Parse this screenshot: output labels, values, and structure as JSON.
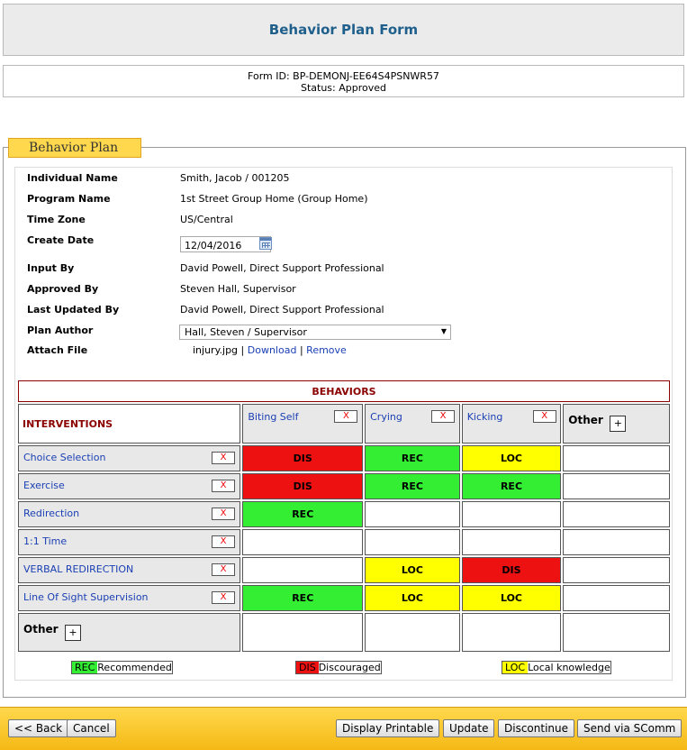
{
  "header": {
    "title": "Behavior Plan Form",
    "form_id": "Form ID: BP-DEMONJ-EE64S4PSNWR57",
    "status": "Status: Approved"
  },
  "section": {
    "legend": "Behavior Plan"
  },
  "fields": {
    "individual_name": {
      "label": "Individual Name",
      "value": "Smith, Jacob / 001205"
    },
    "program_name": {
      "label": "Program Name",
      "value": "1st Street Group Home (Group Home)"
    },
    "time_zone": {
      "label": "Time Zone",
      "value": "US/Central"
    },
    "create_date": {
      "label": "Create Date",
      "value": "12/04/2016"
    },
    "input_by": {
      "label": "Input By",
      "value": "David Powell, Direct Support Professional"
    },
    "approved_by": {
      "label": "Approved By",
      "value": "Steven Hall, Supervisor"
    },
    "last_updated_by": {
      "label": "Last Updated By",
      "value": "David Powell, Direct Support Professional"
    },
    "plan_author": {
      "label": "Plan Author",
      "value": "Hall, Steven / Supervisor"
    },
    "attach_file": {
      "label": "Attach File",
      "filename": "injury.jpg",
      "sep": "|",
      "download": "Download",
      "remove": "Remove"
    }
  },
  "grid": {
    "behaviors_title": "BEHAVIORS",
    "interventions_title": "INTERVENTIONS",
    "other_label": "Other",
    "remove_glyph": "X",
    "add_glyph": "+",
    "behaviors": [
      "Biting Self",
      "Crying",
      "Kicking"
    ],
    "interventions": [
      {
        "name": "Choice Selection",
        "cells": [
          "DIS",
          "REC",
          "LOC",
          ""
        ]
      },
      {
        "name": "Exercise",
        "cells": [
          "DIS",
          "REC",
          "REC",
          ""
        ]
      },
      {
        "name": "Redirection",
        "cells": [
          "REC",
          "",
          "",
          ""
        ]
      },
      {
        "name": "1:1 Time",
        "cells": [
          "",
          "",
          "",
          ""
        ]
      },
      {
        "name": "VERBAL REDIRECTION",
        "cells": [
          "",
          "LOC",
          "DIS",
          ""
        ]
      },
      {
        "name": "Line Of Sight Supervision",
        "cells": [
          "REC",
          "LOC",
          "LOC",
          ""
        ]
      }
    ]
  },
  "legend": {
    "rec": {
      "code": "REC",
      "text": "Recommended",
      "color": "#33ee33"
    },
    "dis": {
      "code": "DIS",
      "text": "Discouraged",
      "color": "#ee1111"
    },
    "loc": {
      "code": "LOC",
      "text": "Local knowledge",
      "color": "#ffff00"
    }
  },
  "footer": {
    "back": "<< Back",
    "cancel": "Cancel",
    "display_printable": "Display Printable",
    "update": "Update",
    "discontinue": "Discontinue",
    "send": "Send via SComm"
  }
}
